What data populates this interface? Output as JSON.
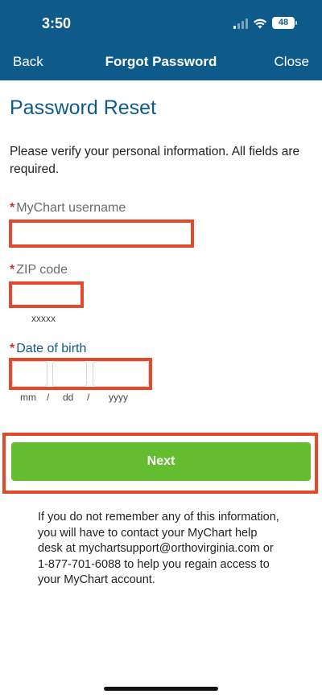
{
  "status_bar": {
    "time": "3:50",
    "battery": "48",
    "icons": [
      "cellular-signal-icon",
      "wifi-icon",
      "battery-icon"
    ]
  },
  "nav": {
    "back_label": "Back",
    "title": "Forgot Password",
    "close_label": "Close"
  },
  "page": {
    "title": "Password Reset",
    "intro": "Please verify your personal information. All fields are required."
  },
  "form": {
    "required_marker": "*",
    "username": {
      "label": "MyChart username",
      "value": ""
    },
    "zip": {
      "label": "ZIP code",
      "value": "",
      "hint": "xxxxx"
    },
    "dob": {
      "label": "Date of birth",
      "mm_hint": "mm",
      "dd_hint": "dd",
      "yyyy_hint": "yyyy",
      "separator": "/"
    }
  },
  "actions": {
    "next_label": "Next"
  },
  "help_text": "If you do not remember any of this information, you will have to contact your MyChart help desk at mychartsupport@orthovirginia.com or 1-877-701-6088 to help you regain access to your MyChart account.",
  "colors": {
    "header_bg": "#0e5a8a",
    "accent_blue": "#0e5a8a",
    "next_green": "#63bd2f",
    "highlight_red": "#e34a2c",
    "required_red": "#c0392b"
  }
}
